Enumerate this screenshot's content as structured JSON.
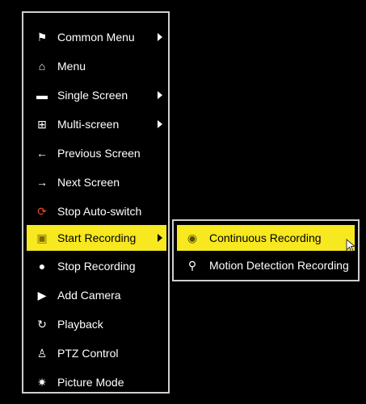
{
  "menu": {
    "items": [
      {
        "label": "Common Menu",
        "icon": "pin-icon",
        "glyph": "⚑",
        "submenu": true
      },
      {
        "label": "Menu",
        "icon": "home-icon",
        "glyph": "⌂",
        "submenu": false
      },
      {
        "label": "Single Screen",
        "icon": "camera-icon",
        "glyph": "▬",
        "submenu": true
      },
      {
        "label": "Multi-screen",
        "icon": "grid-icon",
        "glyph": "⊞",
        "submenu": true
      },
      {
        "label": "Previous Screen",
        "icon": "arrow-left-icon",
        "glyph": "←",
        "submenu": false
      },
      {
        "label": "Next Screen",
        "icon": "arrow-right-icon",
        "glyph": "→",
        "submenu": false
      },
      {
        "label": "Stop Auto-switch",
        "icon": "refresh-icon",
        "glyph": "⟳",
        "submenu": false
      },
      {
        "label": "Start Recording",
        "icon": "record-icon",
        "glyph": "▣",
        "submenu": true,
        "active": true
      },
      {
        "label": "Stop Recording",
        "icon": "stop-icon",
        "glyph": "●",
        "submenu": false
      },
      {
        "label": "Add Camera",
        "icon": "add-camera-icon",
        "glyph": "▶",
        "submenu": false
      },
      {
        "label": "Playback",
        "icon": "playback-icon",
        "glyph": "↻",
        "submenu": false
      },
      {
        "label": "PTZ Control",
        "icon": "ptz-icon",
        "glyph": "♙",
        "submenu": false
      },
      {
        "label": "Picture Mode",
        "icon": "sun-icon",
        "glyph": "✷",
        "submenu": false
      }
    ]
  },
  "submenu": {
    "items": [
      {
        "label": "Continuous Recording",
        "icon": "continuous-record-icon",
        "glyph": "◉",
        "active": true
      },
      {
        "label": "Motion Detection Recording",
        "icon": "motion-detect-icon",
        "glyph": "⚲",
        "active": false
      }
    ]
  },
  "colors": {
    "highlight": "#f7e81f",
    "border": "#cfcfcf",
    "background": "#000000"
  }
}
